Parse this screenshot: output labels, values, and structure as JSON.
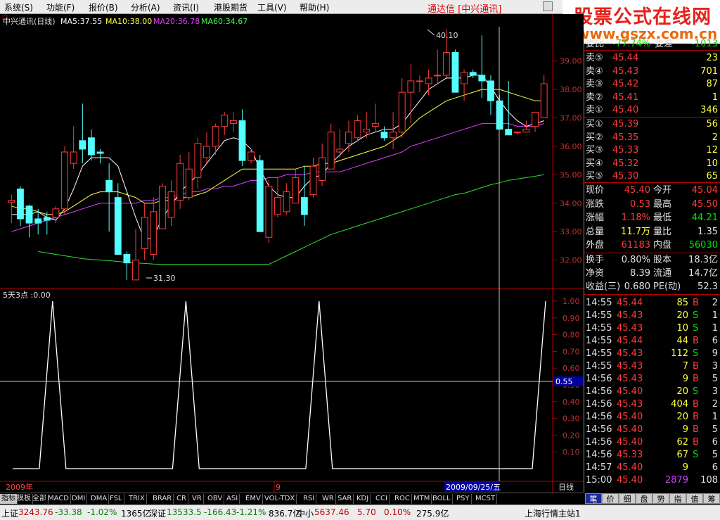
{
  "menu": {
    "items": [
      "系统(S)",
      "功能(F)",
      "报价(B)",
      "分析(A)",
      "资讯(I)",
      "港股期货",
      "工具(V)",
      "帮助(H)"
    ],
    "app_title": "通达信 [中兴通讯]",
    "brand_cn": "股票公式在线网",
    "brand_url": "www.gszx.com.cn"
  },
  "chart": {
    "stock_label": "中兴通讯(日线)",
    "ma5": "MA5:37.55",
    "ma10": "MA10:38.00",
    "ma20": "MA20:36.78",
    "ma60": "MA60:34.67",
    "high_label": "40.10",
    "low_label": "31.30",
    "price_ticks": [
      "39.00",
      "38.00",
      "37.00",
      "36.00",
      "35.00",
      "34.00",
      "33.00",
      "32.00"
    ],
    "indicator_label": "5天3点 :0.00",
    "indicator_ticks": [
      "1.00",
      "0.90",
      "0.80",
      "0.70",
      "0.60",
      "0.50",
      "0.40",
      "0.30",
      "0.20",
      "0.10"
    ],
    "cursor_value": "0.55",
    "date_left": "2009年",
    "date_mid": "9",
    "date_cursor": "2009/09/25/五",
    "period": "日线"
  },
  "chart_data": {
    "type": "candlestick",
    "candles": [
      [
        34.02,
        34.3,
        33.3,
        34.1
      ],
      [
        34.5,
        34.6,
        33.2,
        33.45
      ],
      [
        33.9,
        33.95,
        32.8,
        33.3
      ],
      [
        33.45,
        33.8,
        32.9,
        33.3
      ],
      [
        33.5,
        33.7,
        32.9,
        33.4
      ],
      [
        33.5,
        33.9,
        33.3,
        33.8
      ],
      [
        33.8,
        36.0,
        33.6,
        35.8
      ],
      [
        35.4,
        36.7,
        35.2,
        35.8
      ],
      [
        36.2,
        37.5,
        35.4,
        35.9
      ],
      [
        36.3,
        36.6,
        35.5,
        35.7
      ],
      [
        35.8,
        35.9,
        35.4,
        35.75
      ],
      [
        34.8,
        35.4,
        33.0,
        34.4
      ],
      [
        34.2,
        34.7,
        32.4,
        32.2
      ],
      [
        32.2,
        32.3,
        31.3,
        31.9
      ],
      [
        31.3,
        33.1,
        31.3,
        32.0
      ],
      [
        32.4,
        34.0,
        32.0,
        33.5
      ],
      [
        32.2,
        34.2,
        32.0,
        33.7
      ],
      [
        33.1,
        34.7,
        33.1,
        34.6
      ],
      [
        33.5,
        34.8,
        33.2,
        34.4
      ],
      [
        34.1,
        35.7,
        33.8,
        35.4
      ],
      [
        34.2,
        35.8,
        34.1,
        35.2
      ],
      [
        34.9,
        36.3,
        34.5,
        36.1
      ],
      [
        35.6,
        36.5,
        35.4,
        36.0
      ],
      [
        36.0,
        36.8,
        35.7,
        36.7
      ],
      [
        36.7,
        37.2,
        36.4,
        37.1
      ],
      [
        36.8,
        37.2,
        36.5,
        36.9
      ],
      [
        36.9,
        37.3,
        35.3,
        35.5
      ],
      [
        35.5,
        35.9,
        35.4,
        35.8
      ],
      [
        35.5,
        35.7,
        33.0,
        33.0
      ],
      [
        32.8,
        34.8,
        32.6,
        34.6
      ],
      [
        33.6,
        34.9,
        33.5,
        34.2
      ],
      [
        33.7,
        34.7,
        33.6,
        34.4
      ],
      [
        34.0,
        35.2,
        34.0,
        34.9
      ],
      [
        34.2,
        35.3,
        33.2,
        33.6
      ],
      [
        34.3,
        35.6,
        34.2,
        35.3
      ],
      [
        34.8,
        36.1,
        34.6,
        35.6
      ],
      [
        35.2,
        36.8,
        35.2,
        36.5
      ],
      [
        35.8,
        36.6,
        35.6,
        35.9
      ],
      [
        36.1,
        36.9,
        35.8,
        36.5
      ],
      [
        36.3,
        37.1,
        36.2,
        36.9
      ],
      [
        36.5,
        37.2,
        36.3,
        36.6
      ],
      [
        36.7,
        37.5,
        36.5,
        36.8
      ],
      [
        36.5,
        36.7,
        36.2,
        36.3
      ],
      [
        36.3,
        37.2,
        35.9,
        36.5
      ],
      [
        36.5,
        38.4,
        36.3,
        37.9
      ],
      [
        37.9,
        38.9,
        36.8,
        38.3
      ],
      [
        38.3,
        38.5,
        37.9,
        38.3
      ],
      [
        38.2,
        38.7,
        37.8,
        38.4
      ],
      [
        38.5,
        39.4,
        38.2,
        38.5
      ],
      [
        38.5,
        40.1,
        38.4,
        39.3
      ],
      [
        39.3,
        39.4,
        37.9,
        37.9
      ],
      [
        38.2,
        38.7,
        37.6,
        38.6
      ],
      [
        38.6,
        38.7,
        38.4,
        38.5
      ],
      [
        38.5,
        39.9,
        37.7,
        38.3
      ],
      [
        38.3,
        38.5,
        37.1,
        37.6
      ],
      [
        37.6,
        37.8,
        36.6,
        36.6
      ],
      [
        36.6,
        38.3,
        36.4,
        36.4
      ],
      [
        36.5,
        36.5,
        36.4,
        36.5
      ],
      [
        36.5,
        36.9,
        36.5,
        36.6
      ],
      [
        36.7,
        37.2,
        36.5,
        37.2
      ],
      [
        37.0,
        38.5,
        37.0,
        38.2
      ]
    ],
    "ma5": [
      33.6,
      33.6,
      33.6,
      33.7,
      33.5,
      33.4,
      33.8,
      34.5,
      35.3,
      35.6,
      35.6,
      35.6,
      35.3,
      34.4,
      33.5,
      32.7,
      32.8,
      33.5,
      33.9,
      34.4,
      34.7,
      35.0,
      35.4,
      35.8,
      36.2,
      36.3,
      36.2,
      35.9,
      35.2,
      34.6,
      34.3,
      34.2,
      34.2,
      34.6,
      34.9,
      35.0,
      35.4,
      35.7,
      36.0,
      36.2,
      36.4,
      36.5,
      36.6,
      36.6,
      36.8,
      37.2,
      37.6,
      38.0,
      38.2,
      38.4,
      38.4,
      38.4,
      38.5,
      38.5,
      38.1,
      37.6,
      37.2,
      36.9,
      36.7,
      36.8,
      36.9
    ],
    "ma10": [
      33.9,
      33.8,
      33.8,
      33.7,
      33.6,
      33.6,
      33.7,
      33.9,
      34.1,
      34.3,
      34.4,
      34.4,
      34.4,
      34.3,
      34.2,
      34.0,
      34.0,
      34.1,
      34.1,
      34.2,
      34.2,
      34.3,
      34.4,
      34.6,
      34.8,
      35.0,
      35.2,
      35.2,
      35.2,
      35.2,
      35.2,
      35.2,
      35.2,
      35.3,
      35.3,
      35.4,
      35.4,
      35.5,
      35.6,
      35.7,
      35.8,
      35.9,
      36.0,
      36.2,
      36.4,
      36.7,
      37.0,
      37.2,
      37.4,
      37.6,
      37.7,
      37.8,
      37.9,
      38.0,
      38.0,
      38.0,
      37.9,
      37.8,
      37.7,
      37.6,
      37.6
    ],
    "ma20": [
      33.0,
      33.1,
      33.2,
      33.3,
      33.4,
      33.5,
      33.6,
      33.7,
      33.8,
      33.9,
      34.0,
      34.0,
      34.0,
      34.0,
      34.0,
      34.1,
      34.1,
      34.2,
      34.2,
      34.3,
      34.4,
      34.4,
      34.5,
      34.5,
      34.6,
      34.6,
      34.7,
      34.8,
      34.8,
      34.9,
      34.9,
      35.0,
      35.0,
      35.0,
      35.1,
      35.1,
      35.1,
      35.1,
      35.2,
      35.3,
      35.4,
      35.5,
      35.6,
      35.7,
      35.8,
      36.0,
      36.1,
      36.2,
      36.3,
      36.4,
      36.5,
      36.6,
      36.7,
      36.8,
      36.8,
      36.8,
      36.8,
      36.7,
      36.7,
      36.7,
      36.8
    ],
    "ma60": [
      32.3,
      32.25,
      32.2,
      32.15,
      32.1,
      32.05,
      32.02,
      32.0,
      31.98,
      31.95,
      31.92,
      31.9,
      31.88,
      31.86,
      31.85,
      31.85,
      31.85,
      31.85,
      31.85,
      31.85,
      31.85,
      31.85,
      31.85,
      31.85,
      31.85,
      31.85,
      31.85,
      32.0,
      32.15,
      32.3,
      32.45,
      32.6,
      32.75,
      32.9,
      33.0,
      33.1,
      33.2,
      33.3,
      33.4,
      33.5,
      33.6,
      33.7,
      33.8,
      33.9,
      34.0,
      34.1,
      34.2,
      34.3,
      34.35,
      34.45,
      34.55,
      34.65,
      34.72,
      34.8,
      34.85,
      34.9,
      34.95,
      35.0
    ],
    "indicator": [
      0,
      0,
      0,
      1,
      0,
      0,
      0,
      0,
      0,
      0,
      0,
      0,
      0,
      1,
      0,
      0,
      0,
      0,
      0,
      0,
      0,
      0,
      0,
      1,
      0,
      0,
      0,
      0,
      0,
      0,
      0,
      0,
      0,
      0,
      0,
      0,
      0,
      0,
      0,
      0,
      1
    ]
  },
  "tabs": [
    "指标",
    "模板",
    "全部",
    "MACD",
    "DMI",
    "DMA",
    "FSL",
    "TRIX",
    "BRAR",
    "CR",
    "VR",
    "OBV",
    "ASI",
    "EMV",
    "VOL-TDX",
    "RSI",
    "WR",
    "SAR",
    "KDJ",
    "CCI",
    "ROC",
    "MTM",
    "BOLL",
    "PSY",
    "MCST"
  ],
  "quote": {
    "webi_label": "委比",
    "webi_value": "-77.74%",
    "weicha_label": "委差",
    "weicha_value": "-1013",
    "asks": [
      {
        "label": "卖⑤",
        "price": "45.44",
        "vol": "23"
      },
      {
        "label": "卖④",
        "price": "45.43",
        "vol": "701"
      },
      {
        "label": "卖③",
        "price": "45.42",
        "vol": "87"
      },
      {
        "label": "卖②",
        "price": "45.41",
        "vol": "1"
      },
      {
        "label": "卖①",
        "price": "45.40",
        "vol": "346"
      }
    ],
    "bids": [
      {
        "label": "买①",
        "price": "45.39",
        "vol": "56"
      },
      {
        "label": "买②",
        "price": "45.35",
        "vol": "2"
      },
      {
        "label": "买③",
        "price": "45.33",
        "vol": "12"
      },
      {
        "label": "买④",
        "price": "45.32",
        "vol": "10"
      },
      {
        "label": "买⑤",
        "price": "45.30",
        "vol": "65"
      }
    ],
    "stats": [
      {
        "k1": "现价",
        "v1": "45.40",
        "c1": "red",
        "k2": "今开",
        "v2": "45.04",
        "c2": "red"
      },
      {
        "k1": "涨跌",
        "v1": "0.53",
        "c1": "red",
        "k2": "最高",
        "v2": "45.50",
        "c2": "red"
      },
      {
        "k1": "涨幅",
        "v1": "1.18%",
        "c1": "red",
        "k2": "最低",
        "v2": "44.21",
        "c2": "green"
      },
      {
        "k1": "总量",
        "v1": "11.7万",
        "c1": "yellow",
        "k2": "量比",
        "v2": "1.35",
        "c2": "white"
      },
      {
        "k1": "外盘",
        "v1": "61183",
        "c1": "red",
        "k2": "内盘",
        "v2": "56030",
        "c2": "green"
      }
    ],
    "stats2": [
      {
        "k1": "换手",
        "v1": "0.80%",
        "k2": "股本",
        "v2": "18.3亿"
      },
      {
        "k1": "净资",
        "v1": "8.39",
        "k2": "流通",
        "v2": "14.7亿"
      },
      {
        "k1": "收益(三)",
        "v1": "0.680",
        "k2": "PE(动)",
        "v2": "52.3"
      }
    ],
    "ticks": [
      {
        "t": "14:55",
        "p": "45.44",
        "pc": "red",
        "v": "85",
        "vc": "yellow",
        "s": "B",
        "n": "2"
      },
      {
        "t": "14:55",
        "p": "45.43",
        "pc": "red",
        "v": "20",
        "vc": "yellow",
        "s": "S",
        "n": "1"
      },
      {
        "t": "14:55",
        "p": "45.43",
        "pc": "red",
        "v": "10",
        "vc": "yellow",
        "s": "S",
        "n": "1"
      },
      {
        "t": "14:55",
        "p": "45.44",
        "pc": "red",
        "v": "44",
        "vc": "yellow",
        "s": "B",
        "n": "6"
      },
      {
        "t": "14:55",
        "p": "45.43",
        "pc": "red",
        "v": "112",
        "vc": "yellow",
        "s": "S",
        "n": "9"
      },
      {
        "t": "14:55",
        "p": "45.43",
        "pc": "red",
        "v": "7",
        "vc": "yellow",
        "s": "B",
        "n": "3"
      },
      {
        "t": "14:56",
        "p": "45.43",
        "pc": "red",
        "v": "9",
        "vc": "yellow",
        "s": "B",
        "n": "5"
      },
      {
        "t": "14:56",
        "p": "45.40",
        "pc": "red",
        "v": "20",
        "vc": "yellow",
        "s": "S",
        "n": "3"
      },
      {
        "t": "14:56",
        "p": "45.43",
        "pc": "red",
        "v": "404",
        "vc": "yellow",
        "s": "B",
        "n": "2"
      },
      {
        "t": "14:56",
        "p": "45.40",
        "pc": "red",
        "v": "20",
        "vc": "yellow",
        "s": "B",
        "n": "1"
      },
      {
        "t": "14:56",
        "p": "45.40",
        "pc": "red",
        "v": "9",
        "vc": "yellow",
        "s": "B",
        "n": "5"
      },
      {
        "t": "14:56",
        "p": "45.40",
        "pc": "red",
        "v": "62",
        "vc": "yellow",
        "s": "B",
        "n": "6"
      },
      {
        "t": "14:56",
        "p": "45.33",
        "pc": "red",
        "v": "67",
        "vc": "yellow",
        "s": "S",
        "n": "5"
      },
      {
        "t": "14:57",
        "p": "45.40",
        "pc": "red",
        "v": "9",
        "vc": "yellow",
        "s": "",
        "n": "6"
      },
      {
        "t": "15:00",
        "p": "45.40",
        "pc": "red",
        "v": "2879",
        "vc": "purple",
        "s": "",
        "n": "108"
      }
    ]
  },
  "right_tabs": [
    "笔",
    "价",
    "细",
    "盘",
    "势",
    "指",
    "值",
    "筹"
  ],
  "status": {
    "sh_label": "上证",
    "sh_val": "3243.76",
    "sh_chg": "-33.38",
    "sh_pct": "-1.02%",
    "sh_amt": "1365亿",
    "sz_label": "深证",
    "sz_val": "13533.5",
    "sz_chg": "-166.43",
    "sz_pct": "-1.21%",
    "sz_amt": "836.7亿",
    "zx_label": "中小",
    "zx_val": "5637.46",
    "zx_chg": "5.70",
    "zx_pct": "0.10%",
    "zx_amt": "275.9亿",
    "server": "上海行情主站1"
  }
}
